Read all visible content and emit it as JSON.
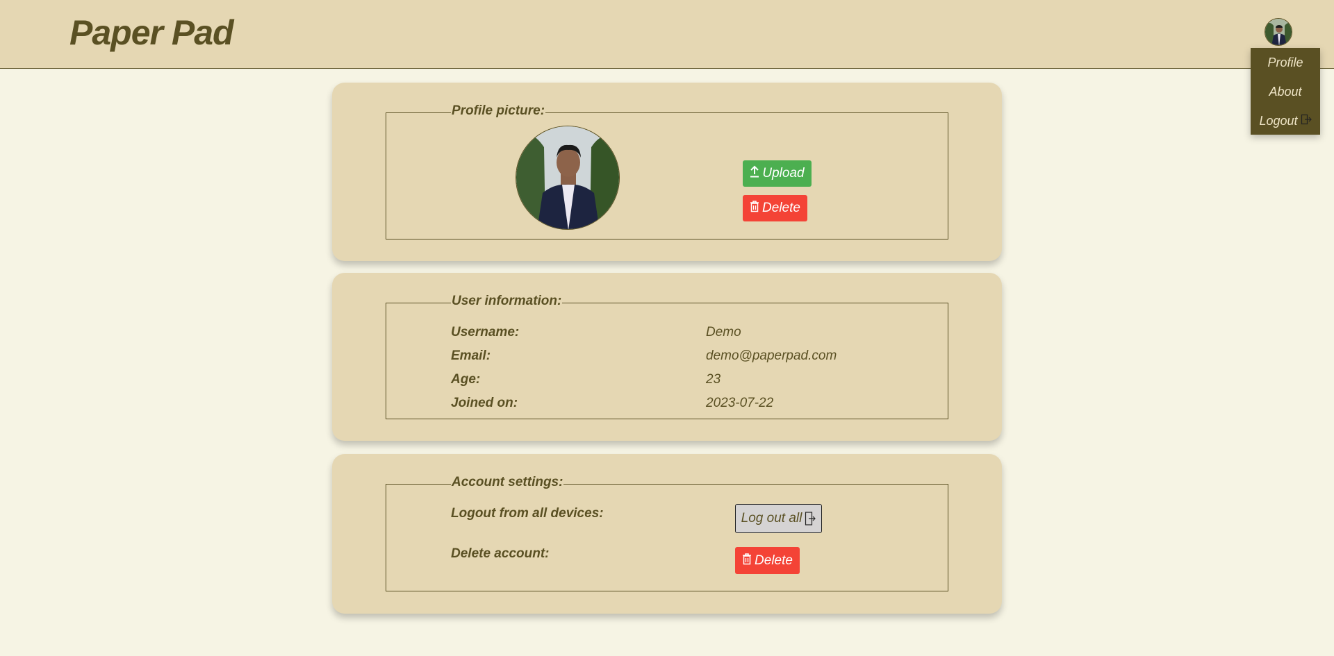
{
  "app": {
    "title": "Paper Pad"
  },
  "menu": {
    "items": [
      {
        "label": "Profile"
      },
      {
        "label": "About"
      },
      {
        "label": "Logout"
      }
    ]
  },
  "profile_picture": {
    "legend": "Profile picture:",
    "upload_label": "Upload",
    "delete_label": "Delete"
  },
  "user_info": {
    "legend": "User information:",
    "rows": [
      {
        "label": "Username:",
        "value": "Demo"
      },
      {
        "label": "Email:",
        "value": "demo@paperpad.com"
      },
      {
        "label": "Age:",
        "value": "23"
      },
      {
        "label": "Joined on:",
        "value": "2023-07-22"
      }
    ]
  },
  "account_settings": {
    "legend": "Account settings:",
    "logout_all_label": "Logout from all devices:",
    "logout_all_button": "Log out all",
    "delete_account_label": "Delete account:",
    "delete_account_button": "Delete"
  },
  "colors": {
    "page_bg": "#f6f4e4",
    "card_bg": "#e5d7b3",
    "text": "#5a5023",
    "menu_bg": "#5a5023",
    "upload_green": "#4caf50",
    "delete_red": "#f44336"
  },
  "icons": {
    "upload": "upload-icon",
    "delete": "trash-icon",
    "logout": "logout-icon"
  }
}
